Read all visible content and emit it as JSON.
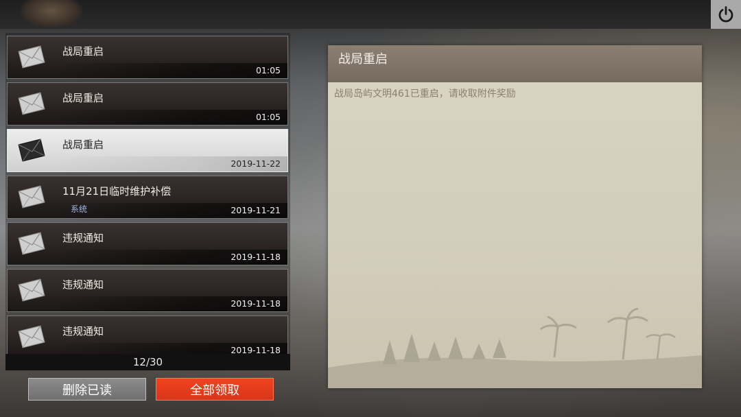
{
  "app": {
    "power_icon": "power-icon",
    "accent_color": "#e03a1c"
  },
  "mail_list": {
    "items": [
      {
        "title": "战局重启",
        "date": "01:05",
        "tag": "",
        "selected": false,
        "icon": "envelope-icon"
      },
      {
        "title": "战局重启",
        "date": "01:05",
        "tag": "",
        "selected": false,
        "icon": "envelope-icon"
      },
      {
        "title": "战局重启",
        "date": "2019-11-22",
        "tag": "",
        "selected": true,
        "icon": "envelope-icon"
      },
      {
        "title": "11月21日临时维护补偿",
        "date": "2019-11-21",
        "tag": "系统",
        "selected": false,
        "icon": "envelope-icon"
      },
      {
        "title": "违规通知",
        "date": "2019-11-18",
        "tag": "",
        "selected": false,
        "icon": "envelope-icon"
      },
      {
        "title": "违规通知",
        "date": "2019-11-18",
        "tag": "",
        "selected": false,
        "icon": "envelope-icon"
      },
      {
        "title": "违规通知",
        "date": "2019-11-18",
        "tag": "",
        "selected": false,
        "icon": "envelope-icon"
      }
    ],
    "counter": "12/30"
  },
  "actions": {
    "delete_read_label": "删除已读",
    "claim_all_label": "全部领取"
  },
  "detail": {
    "title": "战局重启",
    "body": "战局岛屿文明461已重启，请收取附件奖励"
  }
}
